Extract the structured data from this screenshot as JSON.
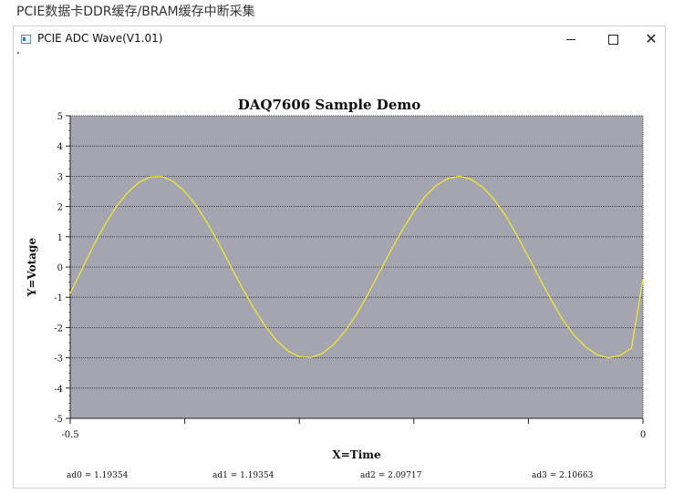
{
  "caption": "PCIE数据卡DDR缓存/BRAM缓存中断采集",
  "window": {
    "title": "PCIE ADC Wave(V1.01)",
    "controls": {
      "minimize": "–",
      "maximize": "☐",
      "close": "✕"
    }
  },
  "chart_data": {
    "type": "line",
    "title": "DAQ7606 Sample Demo",
    "xlabel": "X=Time",
    "ylabel": "Y=Votage",
    "xlim": [
      -0.5,
      0
    ],
    "ylim": [
      -5,
      5
    ],
    "x_tick_labels": [
      "-0.5",
      "0"
    ],
    "y_ticks": [
      5,
      4,
      3,
      2,
      1,
      0,
      -1,
      -2,
      -3,
      -4,
      -5
    ],
    "grid": true,
    "plot_bg": "#a5a5b1",
    "line_color": "#f2ee26",
    "series": [
      {
        "x": [
          -0.5,
          -0.49,
          -0.48,
          -0.47,
          -0.46,
          -0.45,
          -0.44,
          -0.43,
          -0.42,
          -0.41,
          -0.4,
          -0.39,
          -0.38,
          -0.37,
          -0.36,
          -0.35,
          -0.34,
          -0.33,
          -0.32,
          -0.31,
          -0.3,
          -0.29,
          -0.28,
          -0.27,
          -0.26,
          -0.25,
          -0.24,
          -0.23,
          -0.22,
          -0.21,
          -0.2,
          -0.19,
          -0.18,
          -0.17,
          -0.16,
          -0.15,
          -0.14,
          -0.13,
          -0.12,
          -0.11,
          -0.1,
          -0.09,
          -0.08,
          -0.07,
          -0.06,
          -0.05,
          -0.04,
          -0.03,
          -0.02,
          -0.01,
          0
        ],
        "values": [
          -0.87,
          -0.09,
          0.69,
          1.38,
          1.98,
          2.46,
          2.8,
          2.98,
          2.99,
          2.83,
          2.5,
          2.03,
          1.44,
          0.76,
          0.04,
          -0.68,
          -1.35,
          -1.94,
          -2.42,
          -2.77,
          -2.96,
          -2.99,
          -2.86,
          -2.56,
          -2.12,
          -1.56,
          -0.89,
          -0.17,
          0.55,
          1.23,
          1.84,
          2.34,
          2.71,
          2.93,
          3.0,
          2.9,
          2.64,
          2.24,
          1.7,
          1.05,
          0.33,
          -0.39,
          -1.09,
          -1.74,
          -2.26,
          -2.64,
          -2.9,
          -3.0,
          -2.92,
          -2.68,
          -0.4
        ]
      }
    ]
  },
  "status": {
    "ad0": "ad0 =  1.19354",
    "ad1": "ad1 =  1.19354",
    "ad2": "ad2 =  2.09717",
    "ad3": "ad3 =  2.10663"
  }
}
